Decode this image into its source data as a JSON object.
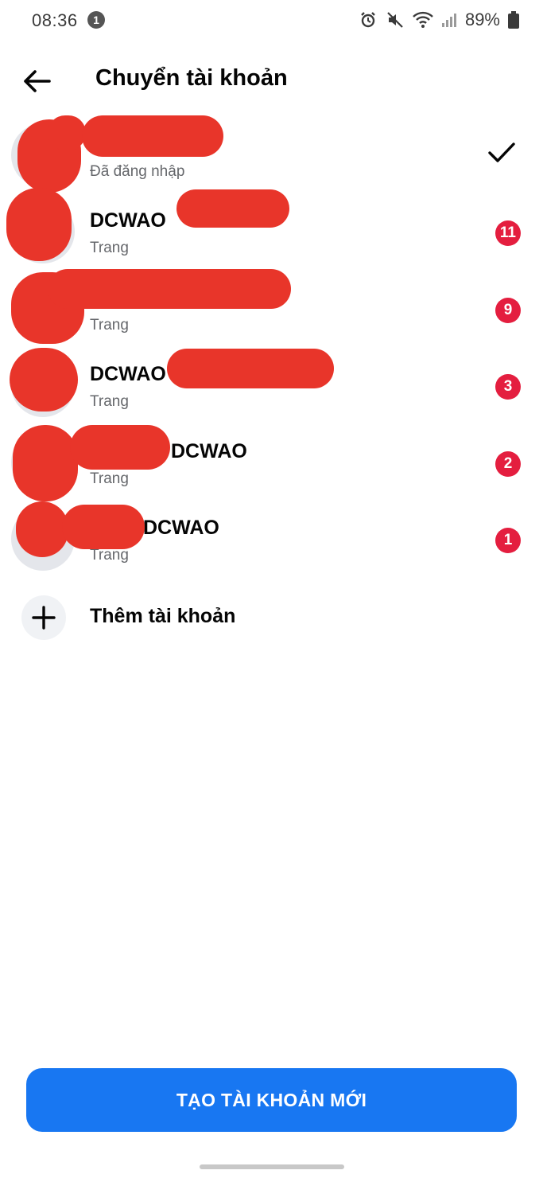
{
  "status_bar": {
    "time": "08:36",
    "notification_count": "1",
    "battery": "89%"
  },
  "header": {
    "title": "Chuyển tài khoản"
  },
  "accounts": [
    {
      "name": "",
      "subtitle": "Đã đăng nhập",
      "badge": "",
      "selected": true
    },
    {
      "name": "DCWAO",
      "subtitle": "Trang",
      "badge": "11"
    },
    {
      "name": "",
      "subtitle": "Trang",
      "badge": "9"
    },
    {
      "name": "DCWAO",
      "subtitle": "Trang",
      "badge": "3"
    },
    {
      "name": "DCWAO",
      "subtitle": "Trang",
      "badge": "2"
    },
    {
      "name": "DCWAO",
      "subtitle": "Trang",
      "badge": "1"
    }
  ],
  "add_account": {
    "label": "Thêm tài khoản"
  },
  "create_button": {
    "label": "TẠO TÀI KHOẢN MỚI"
  },
  "colors": {
    "primary": "#1877f2",
    "badge": "#e41e3f",
    "redaction": "#e8352a"
  }
}
